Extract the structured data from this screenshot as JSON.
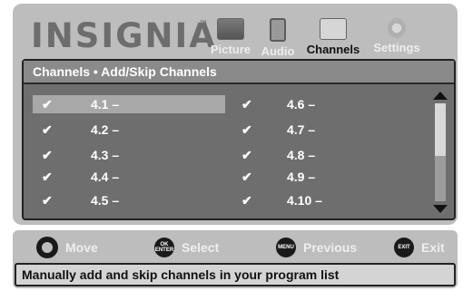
{
  "brand": {
    "logo_text": "INSIGNIA",
    "trademark": "™"
  },
  "tabs": [
    {
      "label": "Picture",
      "icon": "picture-icon",
      "active": false
    },
    {
      "label": "Audio",
      "icon": "audio-icon",
      "active": false
    },
    {
      "label": "Channels",
      "icon": "channels-icon",
      "active": true
    },
    {
      "label": "Settings",
      "icon": "settings-icon",
      "active": false
    }
  ],
  "panel": {
    "title": "Channels • Add/Skip Channels",
    "channels_left": [
      {
        "check": "✔",
        "number": "4.1 –",
        "selected": true
      },
      {
        "check": "✔",
        "number": "4.2 –",
        "selected": false
      },
      {
        "check": "✔",
        "number": "4.3 –",
        "selected": false
      },
      {
        "check": "✔",
        "number": "4.4 –",
        "selected": false
      },
      {
        "check": "✔",
        "number": "4.5 –",
        "selected": false
      }
    ],
    "channels_right": [
      {
        "check": "✔",
        "number": "4.6 –",
        "selected": false
      },
      {
        "check": "✔",
        "number": "4.7 –",
        "selected": false
      },
      {
        "check": "✔",
        "number": "4.8 –",
        "selected": false
      },
      {
        "check": "✔",
        "number": "4.9 –",
        "selected": false
      },
      {
        "check": "✔",
        "number": "4.10 –",
        "selected": false
      }
    ],
    "scroll_fraction": 0.5
  },
  "help": {
    "move": {
      "label": "Move",
      "icon": "dpad-icon"
    },
    "select": {
      "label": "Select",
      "badge": "OK ENTER",
      "icon": "ok-enter-icon"
    },
    "previous": {
      "label": "Previous",
      "badge": "MENU",
      "icon": "menu-icon"
    },
    "exit": {
      "label": "Exit",
      "badge": "EXIT",
      "icon": "exit-icon"
    }
  },
  "description": "Manually add and skip channels in your program list",
  "colors": {
    "frame": "#bdbdbd",
    "panel": "#6e6e6e",
    "selected_row": "#a8a8a8"
  }
}
